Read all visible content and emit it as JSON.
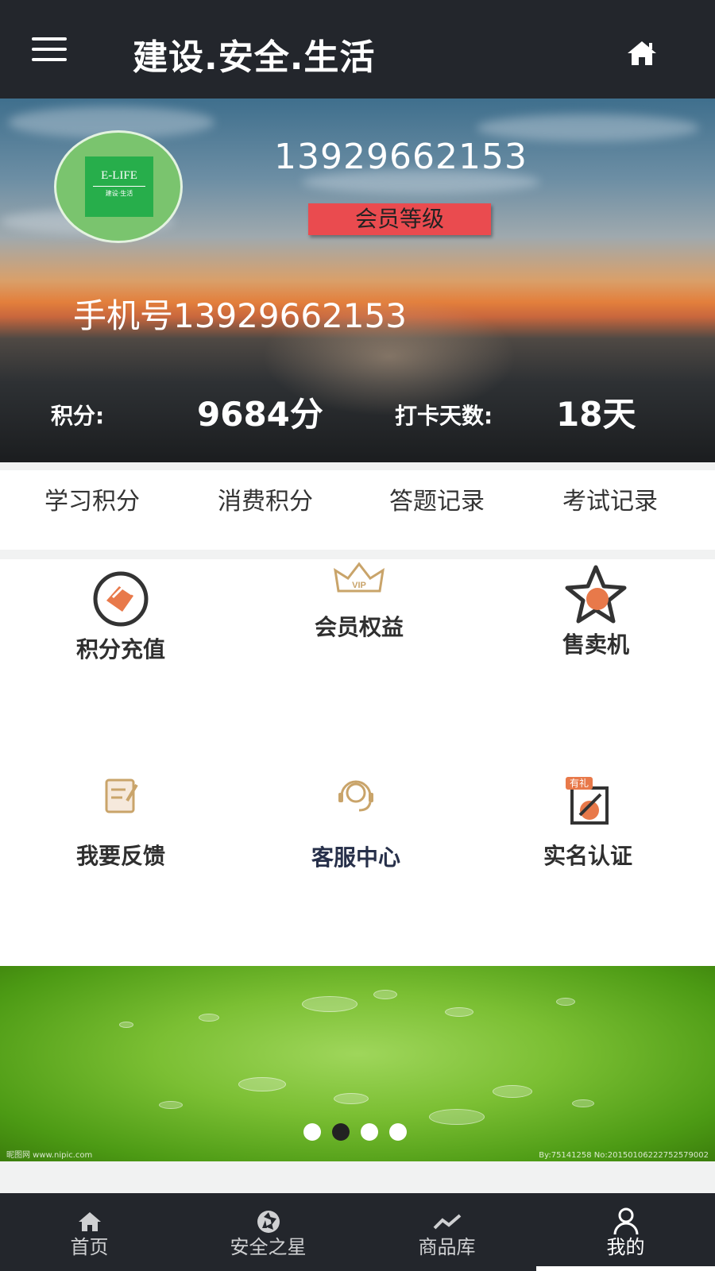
{
  "header": {
    "title": "建设.安全.生活",
    "menu_icon": "hamburger-icon",
    "home_icon": "home-icon"
  },
  "profile": {
    "avatar_logo_text": "E-LIFE",
    "avatar_logo_subtext": "建设·生活",
    "number": "13929662153",
    "member_level": "会员等级",
    "phone": "手机号13929662153",
    "points_label": "积分:",
    "points_value": "9684分",
    "checkin_label": "打卡天数:",
    "checkin_value": "18天"
  },
  "links": [
    {
      "label": "学习积分"
    },
    {
      "label": "消费积分"
    },
    {
      "label": "答题记录"
    },
    {
      "label": "考试记录"
    }
  ],
  "features": [
    {
      "label": "积分充值",
      "icon": "recharge-icon"
    },
    {
      "label": "会员权益",
      "icon": "vip-crown-icon"
    },
    {
      "label": "售卖机",
      "icon": "star-icon"
    },
    {
      "label": "我要反馈",
      "icon": "feedback-icon"
    },
    {
      "label": "客服中心",
      "icon": "headset-icon"
    },
    {
      "label": "实名认证",
      "icon": "verify-icon",
      "badge": "有礼"
    }
  ],
  "banner": {
    "caption_left": "昵图网 www.nipic.com",
    "caption_right": "By:75141258 No:20150106222752579002",
    "dots": 4,
    "active_dot": 1
  },
  "tabs": [
    {
      "label": "首页",
      "icon": "home-icon"
    },
    {
      "label": "安全之星",
      "icon": "aperture-icon"
    },
    {
      "label": "商品库",
      "icon": "trend-icon"
    },
    {
      "label": "我的",
      "icon": "user-icon"
    }
  ],
  "active_tab": 3,
  "colors": {
    "topbar": "#23262c",
    "member_badge": "#ea4b4f",
    "avatar_green": "#27ae4b",
    "accent_orange": "#e8794a"
  }
}
